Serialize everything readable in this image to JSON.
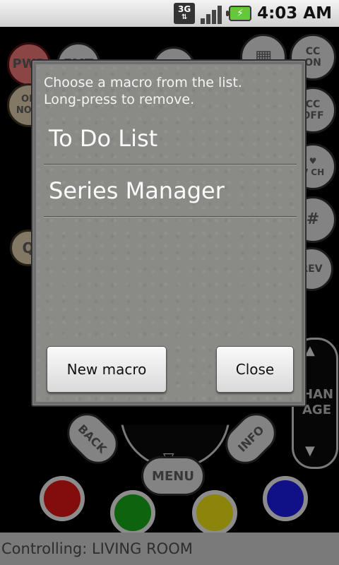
{
  "status_bar": {
    "network_label": "3G",
    "time": "4:03 AM",
    "battery_symbol": "⚡"
  },
  "remote": {
    "pwr": "PWR",
    "fmt": "FMT",
    "on_now": "ON\nNOW",
    "keypad_symbol": "▦",
    "cc_on": "CC\nON",
    "cc_off": "CC\nOFF",
    "fav_ch": "♥\nV CH",
    "hash": "#",
    "search_symbol": "Q",
    "rev": "REV",
    "chan_page": "HAN\nAGE",
    "back": "BACK",
    "info": "INFO",
    "menu": "MENU",
    "down_arrow": "▽",
    "up_arrow": "▲",
    "down_arrow_ch": "▼",
    "colors": {
      "red": "#c81414",
      "green": "#169a16",
      "yellow": "#d8cc12",
      "blue": "#1a1ad0"
    }
  },
  "footer": {
    "text": "Controlling:  LIVING ROOM"
  },
  "dialog": {
    "prompt": "Choose a macro from the list.\nLong-press to remove.",
    "items": [
      {
        "label": "To Do List"
      },
      {
        "label": "Series Manager"
      }
    ],
    "new_button": "New macro",
    "close_button": "Close"
  }
}
